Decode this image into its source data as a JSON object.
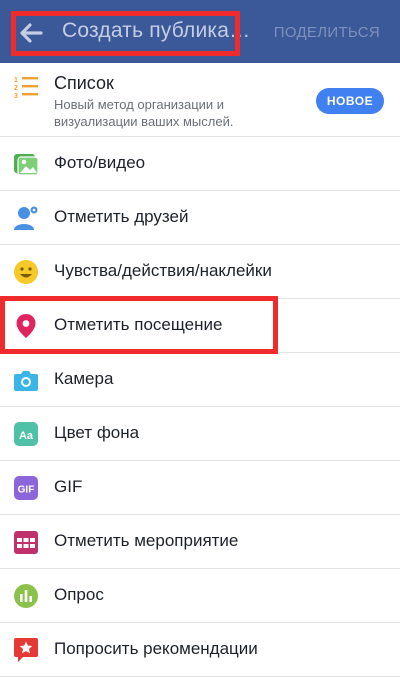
{
  "header": {
    "title": "Создать публика…",
    "share_label": "ПОДЕЛИТЬСЯ",
    "back_icon": "arrow-left-icon",
    "background_color": "#3b5998"
  },
  "menu": {
    "list": {
      "label": "Список",
      "description": "Новый метод организации и визуализации ваших мыслей.",
      "badge": "НОВОЕ",
      "icon": "numbered-list-icon"
    },
    "items": [
      {
        "label": "Фото/видео",
        "icon": "photo-video-icon",
        "color": "#4caf50"
      },
      {
        "label": "Отметить друзей",
        "icon": "tag-friends-icon",
        "color": "#4a90e2"
      },
      {
        "label": "Чувства/действия/наклейки",
        "icon": "smiley-icon",
        "color": "#f7c928"
      },
      {
        "label": "Отметить посещение",
        "icon": "location-pin-icon",
        "color": "#e0245e"
      },
      {
        "label": "Камера",
        "icon": "camera-icon",
        "color": "#3bb4e6"
      },
      {
        "label": "Цвет фона",
        "icon": "background-color-icon",
        "color": "#4fc1a6"
      },
      {
        "label": "GIF",
        "icon": "gif-icon",
        "color": "#8c66d9"
      },
      {
        "label": "Отметить мероприятие",
        "icon": "calendar-icon",
        "color": "#c0306a"
      },
      {
        "label": "Опрос",
        "icon": "poll-icon",
        "color": "#8bc34a"
      },
      {
        "label": "Попросить рекомендации",
        "icon": "recommendation-icon",
        "color": "#e53935"
      }
    ]
  }
}
